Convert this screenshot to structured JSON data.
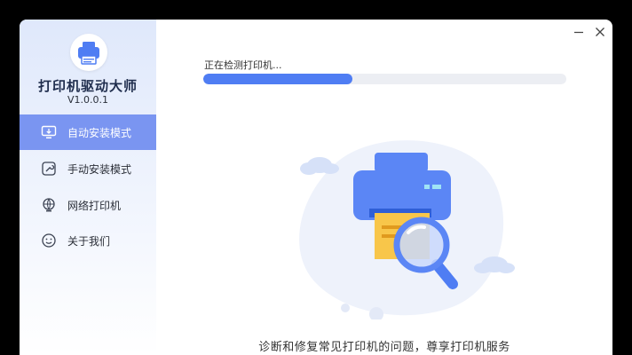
{
  "app": {
    "title": "打印机驱动大师",
    "version": "V1.0.0.1"
  },
  "sidebar": {
    "items": [
      {
        "label": "自动安装模式",
        "icon": "monitor-icon",
        "active": true
      },
      {
        "label": "手动安装模式",
        "icon": "hand-wrench-icon",
        "active": false
      },
      {
        "label": "网络打印机",
        "icon": "network-globe-icon",
        "active": false
      },
      {
        "label": "关于我们",
        "icon": "smiley-icon",
        "active": false
      }
    ]
  },
  "window_controls": {
    "minimize_icon": "minimize-icon",
    "close_icon": "close-icon"
  },
  "main": {
    "status_text": "正在检测打印机...",
    "progress_fraction": 0.41,
    "caption": "诊断和修复常见打印机的问题，尊享打印机服务"
  },
  "colors": {
    "accent": "#4f7df3",
    "sidebar_active": "#7a95f1",
    "printer_body": "#5b86f5",
    "paper": "#f8c64a",
    "blob": "#eef2fb"
  }
}
